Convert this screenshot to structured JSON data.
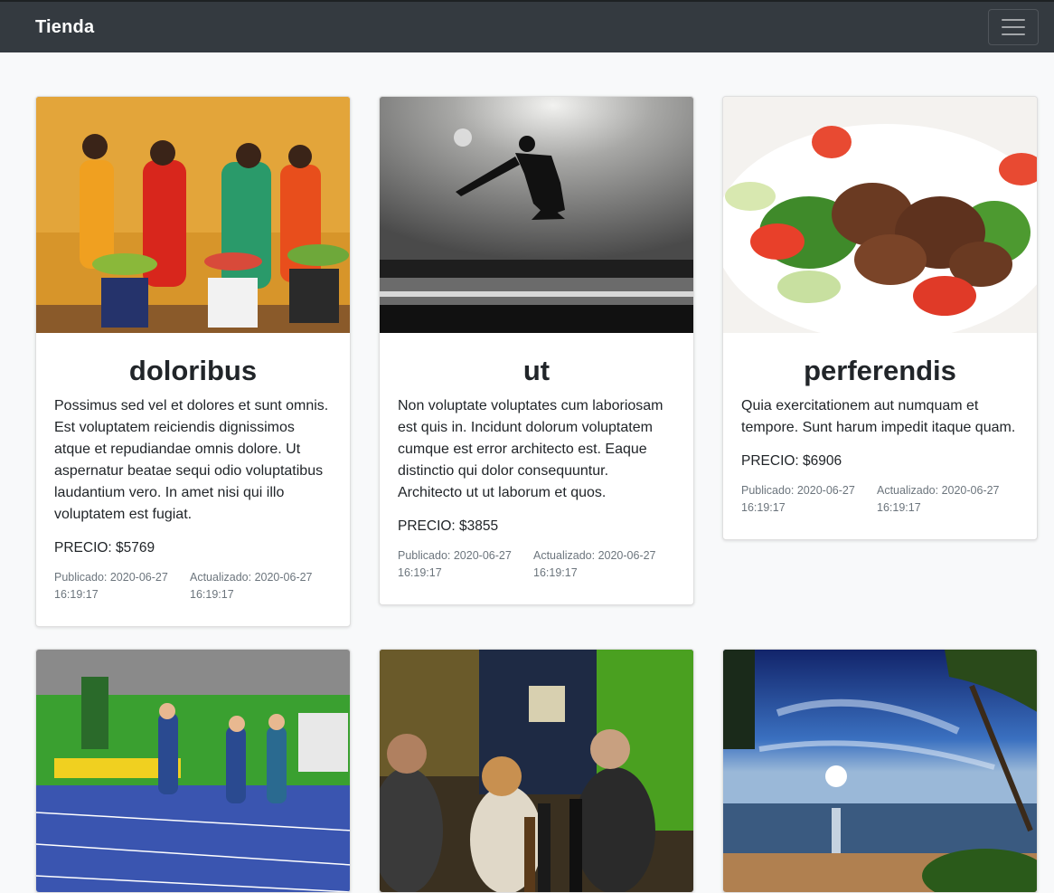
{
  "navbar": {
    "brand": "Tienda",
    "toggler_icon": "hamburger-menu-icon"
  },
  "products": [
    {
      "image": "women-traditional-dresses-fruit",
      "title": "doloribus",
      "description": "Possimus sed vel et dolores et sunt omnis. Est voluptatem reiciendis dignissimos atque et repudiandae omnis dolore. Ut aspernatur beatae sequi odio voluptatibus laudantium vero. In amet nisi qui illo voluptatem est fugiat.",
      "price": "PRECIO: $5769",
      "published": "Publicado: 2020-06-27 16:19:17",
      "updated": "Actualizado: 2020-06-27 16:19:17"
    },
    {
      "image": "martial-arts-jump-silhouette",
      "title": "ut",
      "description": "Non voluptate voluptates cum laboriosam est quis in. Incidunt dolorum voluptatem cumque est error architecto est. Eaque distinctio qui dolor consequuntur. Architecto ut ut laborum et quos.",
      "price": "PRECIO: $3855",
      "published": "Publicado: 2020-06-27 16:19:17",
      "updated": "Actualizado: 2020-06-27 16:19:17"
    },
    {
      "image": "beef-salad-plate",
      "title": "perferendis",
      "description": "Quia exercitationem aut numquam et tempore. Sunt harum impedit itaque quam.",
      "price": "PRECIO: $6906",
      "published": "Publicado: 2020-06-27 16:19:17",
      "updated": "Actualizado: 2020-06-27 16:19:17"
    },
    {
      "image": "athletes-running-track"
    },
    {
      "image": "people-in-bar"
    },
    {
      "image": "tropical-beach-sunset"
    }
  ]
}
